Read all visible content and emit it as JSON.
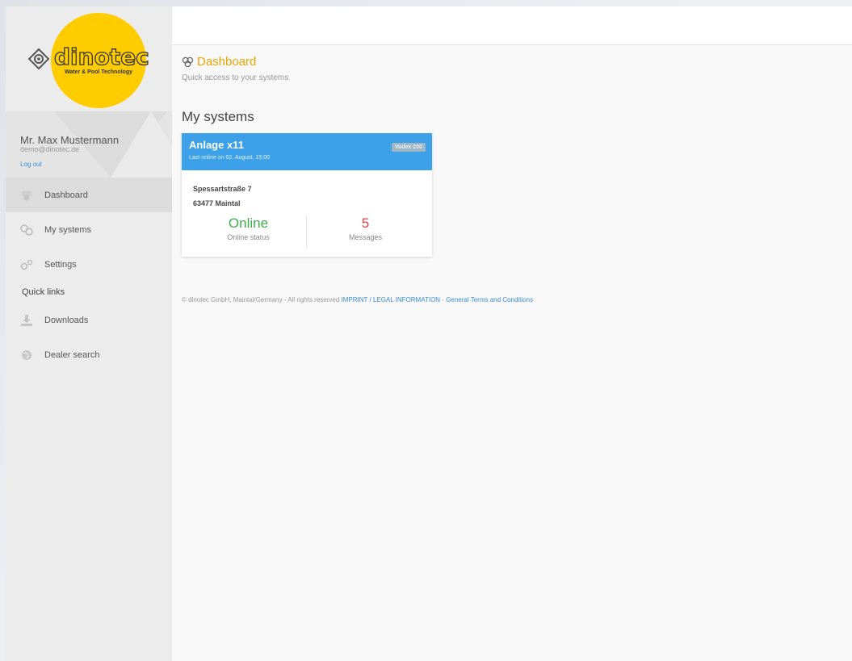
{
  "brand": {
    "name": "dinotec",
    "tagline": "Water & Pool Technology",
    "colors": {
      "primary": "#ffcc00",
      "accent": "#3ca1e8",
      "title": "#f0a500"
    }
  },
  "user": {
    "name": "Mr. Max Mustermann",
    "email": "demo@dinotec.de",
    "logout_label": "Log out"
  },
  "nav": {
    "items": [
      {
        "label": "Dashboard",
        "icon": "dashboard-icon",
        "active": true
      },
      {
        "label": "My systems",
        "icon": "systems-icon",
        "active": false
      },
      {
        "label": "Settings",
        "icon": "settings-icon",
        "active": false
      }
    ],
    "quick_links_heading": "Quick links",
    "quick_links": [
      {
        "label": "Downloads",
        "icon": "download-icon"
      },
      {
        "label": "Dealer search",
        "icon": "globe-icon"
      }
    ]
  },
  "page": {
    "title": "Dashboard",
    "subtitle": "Quick access to your systems",
    "section_title": "My systems"
  },
  "system_card": {
    "name": "Anlage x11",
    "last_online": "Last online on 02. August, 15:00",
    "badge": "Vodex 200",
    "address_line1": "Spessartstraße 7",
    "address_line2": "63477 Maintal",
    "status_value": "Online",
    "status_label": "Online status",
    "messages_value": "5",
    "messages_label": "Messages"
  },
  "footer": {
    "text": "© dinotec GmbH, Maintal/Germany - All rights reserved",
    "imprint_link": "IMPRINT / LEGAL INFORMATION",
    "separator": " - ",
    "terms_link": "General Terms and Conditions"
  }
}
